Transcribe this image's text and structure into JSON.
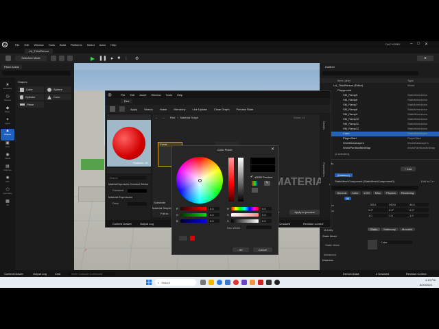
{
  "editor": {
    "title": "Lvl_ThirdPerson",
    "project": "DACVOBB1",
    "menu": [
      "File",
      "Edit",
      "Window",
      "Tools",
      "Build",
      "Platforms",
      "Select",
      "Actor",
      "Help"
    ],
    "mode": "Selection Mode",
    "viewport_mode": "Perspective",
    "lit": "Lit",
    "snap_value": "10",
    "angle_value": "10°",
    "scale_value": "0.25"
  },
  "place_actors": {
    "title": "Place Actors",
    "section": "Shapes",
    "shapes": [
      "Cube",
      "Sphere",
      "Cylinder",
      "Cone",
      "Plane"
    ],
    "rail": [
      "Favorites",
      "Recent",
      "Basic",
      "Lights",
      "Shapes",
      "Cine",
      "Visual",
      "Volumes",
      "VFX",
      "Geometry",
      "All"
    ]
  },
  "outliner": {
    "title": "Outliner",
    "col_label": "Item Label",
    "col_type": "Type",
    "items": [
      {
        "label": "Lvl_ThirdPerson (Editor)",
        "type": "World"
      },
      {
        "label": "Playground",
        "type": ""
      },
      {
        "label": "SM_Ramp5",
        "type": "StaticMeshActor"
      },
      {
        "label": "SM_Ramp6",
        "type": "StaticMeshActor"
      },
      {
        "label": "SM_Ramp7",
        "type": "StaticMeshActor"
      },
      {
        "label": "SM_Ramp8",
        "type": "StaticMeshActor"
      },
      {
        "label": "SM_Ramp9",
        "type": "StaticMeshActor"
      },
      {
        "label": "SM_Ramp10",
        "type": "StaticMeshActor"
      },
      {
        "label": "SM_Ramp11",
        "type": "StaticMeshActor"
      },
      {
        "label": "SM_Ramp12",
        "type": "StaticMeshActor"
      },
      {
        "label": "Cube",
        "type": "StaticMeshActor"
      },
      {
        "label": "PlayerStart",
        "type": "PlayerStart"
      },
      {
        "label": "WorldDataLayers",
        "type": "WorldDataLayers"
      },
      {
        "label": "WorldPartitionMiniMap",
        "type": "WorldPartitionMiniMap"
      }
    ],
    "selected_count": "(1 selected)"
  },
  "details": {
    "title": "Details",
    "add_label": "+ Add",
    "instance": "Cube",
    "instance_label": "(Instance)",
    "component": "StaticMeshComponent (StaticMeshComponent0)",
    "edit_cpp": "Edit in C++",
    "tabs": [
      "General",
      "Actor",
      "LOD",
      "Misc",
      "Physics",
      "Rendering"
    ],
    "all_tab": "All",
    "location": [
      "-720.0",
      "290.0",
      "40.0"
    ],
    "rotation": [
      "0.0°",
      "0.0°",
      "0.0°"
    ],
    "scale": [
      "1.0",
      "1.0",
      "1.0"
    ],
    "loc_label": "Location",
    "rot_label": "Rotation",
    "scale_label": "Scale",
    "mobility_label": "Mobility",
    "mobility_options": [
      "Static",
      "Stationary",
      "Movable"
    ],
    "static_mesh_header": "Static Mesh",
    "static_mesh_label": "Static Mesh",
    "static_mesh_value": "Cube",
    "advanced": "Advanced",
    "materials": "Materials"
  },
  "statusbar": {
    "content_drawer": "Content Drawer",
    "output_log": "Output Log",
    "cmd": "Cmd",
    "console_placeholder": "Enter Console Command",
    "derived": "Derived Data",
    "unsaved": "2 Unsaved",
    "revision": "Revision Control"
  },
  "taskbar": {
    "search": "Search",
    "time": "4:13 PM",
    "date": "8/20/2024"
  },
  "material": {
    "tab": "Red",
    "menu": [
      "File",
      "Edit",
      "Asset",
      "Window",
      "Tools",
      "Help"
    ],
    "toolbar": [
      "Apply",
      "Search",
      "Home",
      "Hierarchy",
      "Live Update",
      "Clean Graph",
      "Preview State"
    ],
    "breadcrumb_root": "Red",
    "breadcrumb_graph": "Material Graph",
    "zoom": "Zoom 1:1",
    "shaders": "Shaders: 18",
    "search_placeholder": "Search",
    "sections": [
      "Material Expression Constant 3Vector",
      "Constant",
      "Material Expression",
      "Desc"
    ],
    "constant_label": "Constant",
    "desc_label": "Desc",
    "graph_label": "MATERIAL",
    "substrate": "Substrate",
    "material_simple": "Material Simple",
    "full_screen": "Full sc",
    "node_title": "Const",
    "apply_preview": "Apply to preview",
    "save": "Save",
    "content_drawer": "Content Drawer",
    "output_log": "Output Log",
    "unsaved": "2 Unsaved",
    "revision": "Revision Control",
    "side_tab_details": "Details",
    "side_tab_params": "Parameters"
  },
  "color_picker": {
    "title": "Color Picker",
    "srgb_label": "sRGB Preview",
    "hex_label": "Hex sRGB",
    "ok": "OK",
    "cancel": "Cancel",
    "rgb_values": [
      "0.0",
      "0.0",
      "0.0"
    ],
    "hsv_values": [
      "0.0",
      "0.0",
      "0.0"
    ],
    "channels": [
      "R",
      "G",
      "B"
    ],
    "hsv_channels": [
      "H",
      "S",
      "V"
    ],
    "accent_red": "#e00000"
  }
}
